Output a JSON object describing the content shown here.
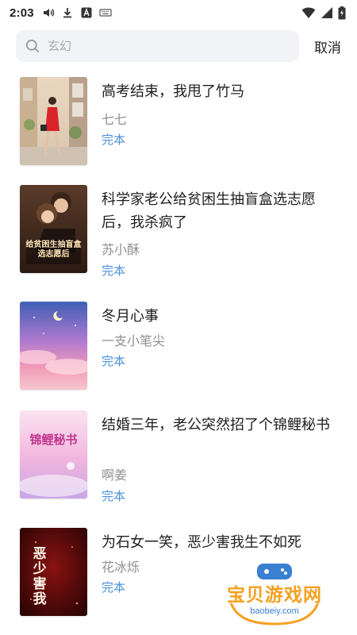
{
  "status_bar": {
    "time": "2:03",
    "icons_left": [
      "volume-icon",
      "download-icon",
      "app-a-icon",
      "keyboard-icon"
    ],
    "icons_right": [
      "wifi-icon",
      "signal-icon",
      "battery-icon"
    ]
  },
  "search": {
    "placeholder": "玄幻",
    "value": "",
    "cancel_label": "取消"
  },
  "books": [
    {
      "title": "高考结束，我甩了竹马",
      "author": "七七",
      "status": "完本"
    },
    {
      "title": "科学家老公给贫困生抽盲盒选志愿后，我杀疯了",
      "author": "苏小酥",
      "status": "完本",
      "cover_text": "给贫困生抽盲盒选志愿后"
    },
    {
      "title": "冬月心事",
      "author": "一支小笔尖",
      "status": "完本"
    },
    {
      "title": "结婚三年，老公突然招了个锦鲤秘书",
      "author": "啊姜",
      "status": "完本",
      "cover_text": "锦鲤秘书"
    },
    {
      "title": "为石女一笑，恶少害我生不如死",
      "author": "花冰烁",
      "status": "完本",
      "cover_text": "恶少害我"
    }
  ],
  "watermark": {
    "title": "宝贝游戏网",
    "url": "baobeiy.com"
  },
  "colors": {
    "status_done": "#4a90d9",
    "author": "#8f8f8f",
    "search_bg": "#f1f3f6",
    "watermark_orange": "#f4a020"
  }
}
